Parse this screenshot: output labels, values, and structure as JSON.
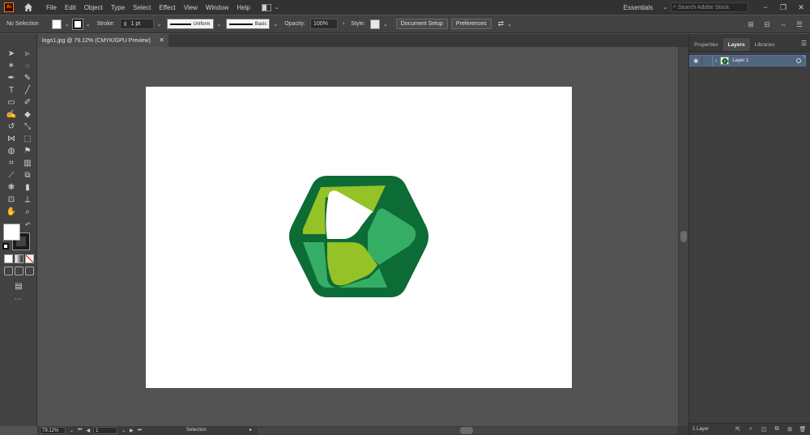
{
  "menubar": {
    "app_badge": "Ai",
    "items": [
      "File",
      "Edit",
      "Object",
      "Type",
      "Select",
      "Effect",
      "View",
      "Window",
      "Help"
    ],
    "workspace": "Essentials",
    "search_placeholder": "Search Adobe Stock"
  },
  "controlbar": {
    "selection_status": "No Selection",
    "stroke_label": "Stroke:",
    "stroke_weight": "1 pt",
    "stroke_profile": "Uniform",
    "brush": "Basic",
    "opacity_label": "Opacity:",
    "opacity_value": "100%",
    "style_label": "Style:",
    "document_setup": "Document Setup",
    "preferences": "Preferences"
  },
  "document": {
    "tab_title": "logo1.jpg @ 79.12% (CMYK/GPU Preview)",
    "artboard_color": "#ffffff"
  },
  "logo_colors": {
    "outer": "#0d6b36",
    "light_green": "#95c226",
    "mid_green": "#36ad65",
    "white": "#ffffff"
  },
  "statusbar": {
    "zoom": "79.12%",
    "page": "1",
    "current_tool": "Selection"
  },
  "panel": {
    "tabs": [
      "Properties",
      "Layers",
      "Libraries"
    ],
    "active_tab": "Layers",
    "layers": [
      {
        "name": "Layer 1",
        "color": "#4e8af0"
      }
    ],
    "footer_count": "1 Layer"
  }
}
